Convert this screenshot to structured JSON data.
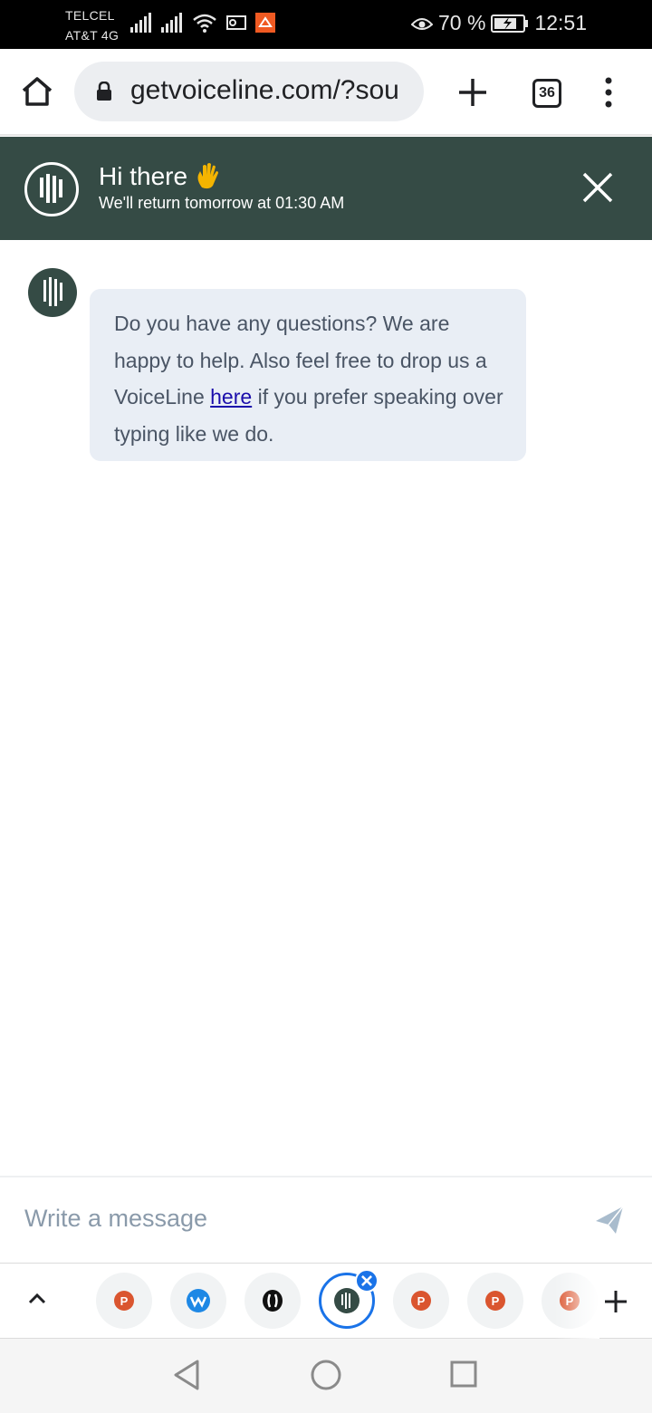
{
  "status_bar": {
    "carrier_1": "TELCEL",
    "carrier_2": "AT&T 4G",
    "battery": "70 %",
    "time": "12:51"
  },
  "browser": {
    "url": "getvoiceline.com/?sou",
    "tab_count": "36"
  },
  "chat": {
    "header_title": "Hi there",
    "header_subtitle": "We'll return tomorrow at 01:30 AM",
    "message_part1": "Do you have any questions? We are happy to help. Also feel free to drop us a VoiceLine",
    "message_link": "here",
    "message_part2": " if you prefer speaking over typing like we do.",
    "input_placeholder": "Write a message"
  },
  "tab_strip": {
    "tabs": [
      {
        "icon": "producthunt-icon",
        "color": "#da552f"
      },
      {
        "icon": "w-logo-icon",
        "color": "#1e88e5"
      },
      {
        "icon": "speaker-logo-icon",
        "color": "#111111"
      },
      {
        "icon": "voiceline-icon",
        "color": "#354b45",
        "active": true
      },
      {
        "icon": "producthunt-icon",
        "color": "#da552f"
      },
      {
        "icon": "producthunt-icon",
        "color": "#da552f"
      },
      {
        "icon": "producthunt-icon",
        "color": "#da552f"
      }
    ]
  },
  "colors": {
    "header_bg": "#354b45",
    "bubble_bg": "#e9eef5",
    "link": "#1a0dab",
    "accent_blue": "#1a73e8"
  }
}
